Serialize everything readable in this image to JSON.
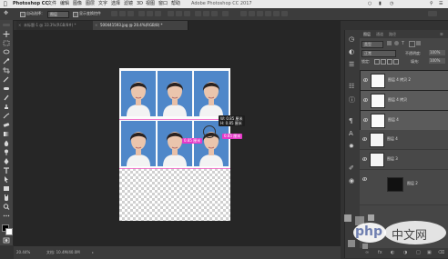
{
  "menubar": {
    "app": "Photoshop CC",
    "items": [
      "文件",
      "编辑",
      "图像",
      "图层",
      "文字",
      "选择",
      "滤镜",
      "3D",
      "视图",
      "窗口",
      "帮助"
    ],
    "window_title": "Adobe Photoshop CC 2017"
  },
  "options": {
    "auto_select_label": "自动选择：",
    "auto_select_value": "图层",
    "show_transform_label": "显示变换控件"
  },
  "tabs": [
    {
      "label": "未标题-1 @ 33.3%(RGB/8#) *"
    },
    {
      "label": "500441593.jpg @ 20.4%(RGB/8) *"
    }
  ],
  "canvas": {
    "tooltip_line1": "W: 0.85 厘米",
    "tooltip_line2": "H: 0.85 厘米",
    "pink_label_1": "0.85 厘米",
    "pink_label_2": "0.85 厘米"
  },
  "status": {
    "zoom": "20.44%",
    "doc": "文档: 10.4M/40.0M"
  },
  "layers": {
    "tabs": [
      "图层",
      "通道",
      "路径"
    ],
    "filter_label": "类型",
    "blend_mode": "正常",
    "opacity_label": "不透明度:",
    "opacity_value": "100%",
    "lock_label": "锁定:",
    "fill_label": "填充:",
    "fill_value": "100%",
    "rows": [
      {
        "name": "图层 4 拷贝 2",
        "selected": true
      },
      {
        "name": "图层 4 拷贝",
        "selected": true
      },
      {
        "name": "图层 4",
        "selected": true
      },
      {
        "name": "图层 4",
        "selected": false
      },
      {
        "name": "图层 3",
        "selected": false
      },
      {
        "name": "图层 2",
        "selected": false
      }
    ]
  },
  "watermark": {
    "brand": "php",
    "text": "中文网"
  },
  "colors": {
    "photo_bg": "#4f87c9",
    "accent_pink": "#e639c9",
    "selected_layer": "#5b5b5b"
  }
}
